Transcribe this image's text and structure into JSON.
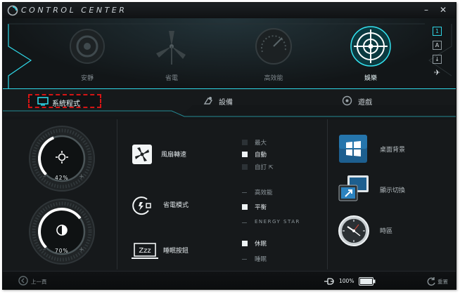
{
  "app": {
    "title": "CONTROL CENTER"
  },
  "modes": [
    {
      "label": "安靜",
      "icon": "speaker-icon",
      "active": false
    },
    {
      "label": "省電",
      "icon": "turbine-icon",
      "active": false
    },
    {
      "label": "高效能",
      "icon": "gauge-icon",
      "active": false
    },
    {
      "label": "娛樂",
      "icon": "target-icon",
      "active": true
    }
  ],
  "side_icons": [
    "1",
    "A",
    "↓",
    "✈"
  ],
  "tabs": [
    {
      "label": "系統程式",
      "icon": "monitor-icon",
      "active": true
    },
    {
      "label": "設備",
      "icon": "devices-icon",
      "active": false
    },
    {
      "label": "遊戲",
      "icon": "gamepad-icon",
      "active": false
    }
  ],
  "dials": [
    {
      "name": "brightness",
      "value": "42%",
      "percent": 42,
      "icon": "brightness-icon"
    },
    {
      "name": "volume",
      "value": "70%",
      "percent": 70,
      "icon": "contrast-icon"
    }
  ],
  "settings": {
    "fan": {
      "label": "風扇轉速",
      "options": [
        {
          "label": "最大",
          "checked": false,
          "style": "box"
        },
        {
          "label": "自動",
          "checked": true,
          "style": "box"
        },
        {
          "label": "自訂",
          "checked": false,
          "style": "box"
        }
      ]
    },
    "power": {
      "label": "省電模式",
      "options": [
        {
          "label": "高效能",
          "checked": false,
          "style": "dash"
        },
        {
          "label": "平衡",
          "checked": true,
          "style": "box"
        },
        {
          "label": "ENERGY STAR",
          "checked": false,
          "style": "dash"
        }
      ]
    },
    "sleep": {
      "label": "睡眠按鈕",
      "options": [
        {
          "label": "休眠",
          "checked": true,
          "style": "box"
        },
        {
          "label": "睡眠",
          "checked": false,
          "style": "dash"
        }
      ]
    }
  },
  "right_items": [
    {
      "label": "桌面背景",
      "icon": "windows-logo-icon"
    },
    {
      "label": "顯示切換",
      "icon": "display-switch-icon"
    },
    {
      "label": "時區",
      "icon": "clock-icon"
    }
  ],
  "bottom": {
    "back_label": "上一頁",
    "battery_percent": "100%",
    "reset_label": "重置"
  },
  "colors": {
    "accent": "#2fd6e6",
    "highlight_border": "#d51515"
  }
}
